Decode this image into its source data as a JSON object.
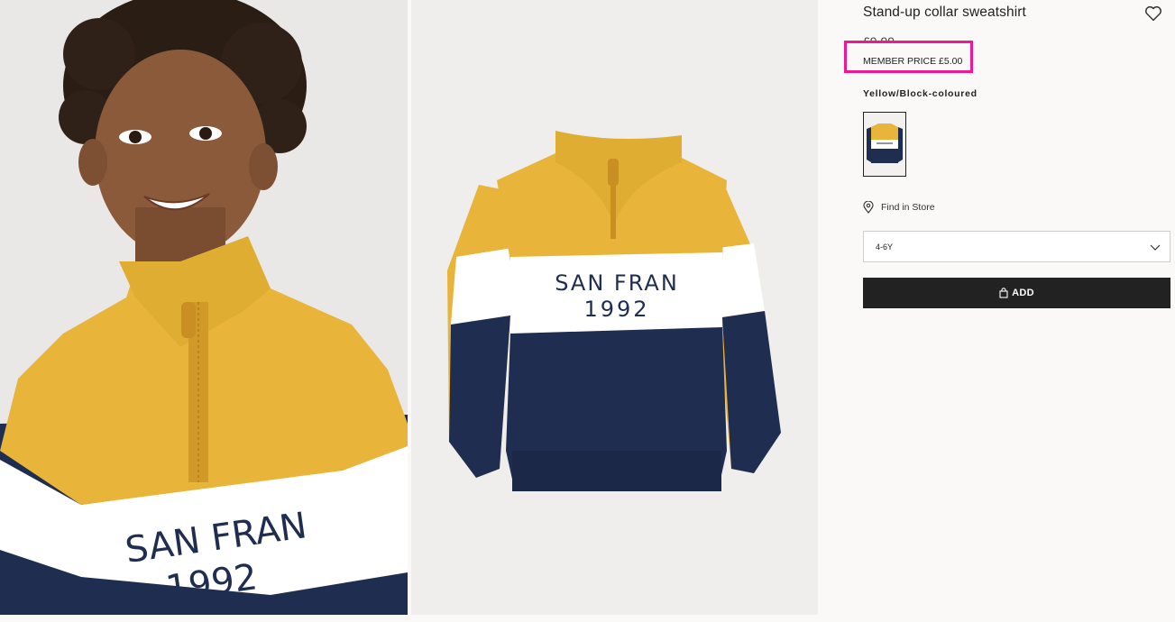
{
  "product": {
    "title": "Stand-up collar sweatshirt",
    "price": "£9.99",
    "member_price": "MEMBER PRICE £5.00",
    "color_name": "Yellow/Block-coloured",
    "store_label": "Find in Store",
    "size_value": "4-6Y",
    "add_label": "ADD",
    "print_line1": "SAN FRAN",
    "print_line2": "1992"
  },
  "icons": {
    "favorite": "heart-icon",
    "store": "location-pin-icon",
    "dropdown": "chevron-down-icon",
    "bag": "shopping-bag-icon"
  },
  "colors": {
    "yellow": "#e8b53a",
    "navy": "#1f2e50",
    "white": "#ffffff",
    "highlight": "#ee1895",
    "button": "#222222"
  }
}
